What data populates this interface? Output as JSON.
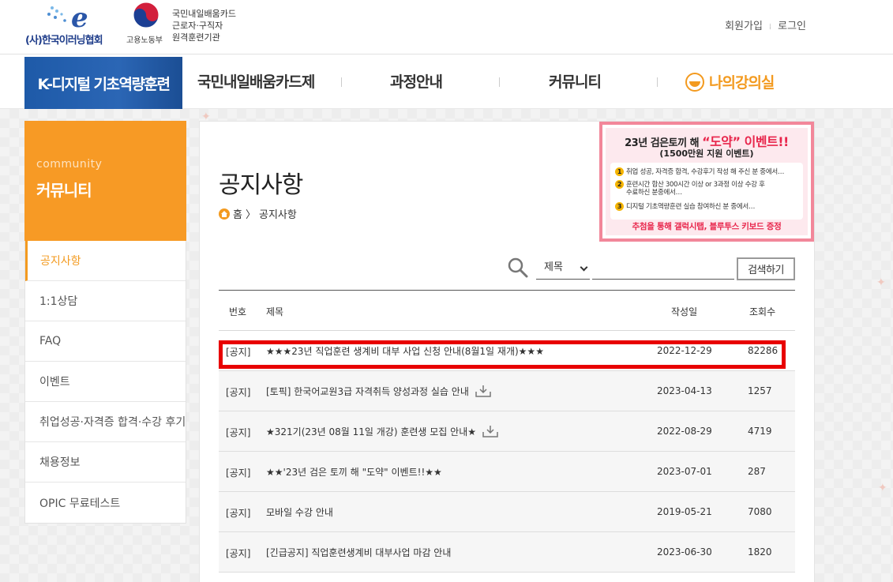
{
  "header": {
    "org_name": "(사)한국이러닝협회",
    "ministry": "고용노동부",
    "gov_lines": [
      "국민내일배움카드",
      "근로자·구직자",
      "원격훈련기관"
    ],
    "links": {
      "signup": "회원가입",
      "login": "로그인"
    }
  },
  "nav": {
    "brand": "K-디지털 기초역량훈련",
    "items": [
      "국민내일배움카드제",
      "과정안내",
      "커뮤니티"
    ],
    "my_lecture": "나의강의실"
  },
  "sidebar": {
    "subtitle": "community",
    "title": "커뮤니티",
    "items": [
      {
        "label": "공지사항",
        "active": true
      },
      {
        "label": "1:1상담"
      },
      {
        "label": "FAQ"
      },
      {
        "label": "이벤트"
      },
      {
        "label": "취업성공·자격증 합격·수강 후기"
      },
      {
        "label": "채용정보"
      },
      {
        "label": "OPIC 무료테스트"
      }
    ]
  },
  "main": {
    "title": "공지사항",
    "breadcrumb": {
      "home": "홈",
      "current": "공지사항"
    }
  },
  "banner": {
    "title_pre": "23년 검은토끼 해",
    "title_hl": "“도약” 이벤트!!",
    "subtitle": "(1500만원 지원 이벤트)",
    "lines": [
      "취업 성공, 자격증 합격, 수강후기 작성 해 주신 분 중에서…",
      "훈련시간 합산 300시간 이상 or 3과정 이상 수강 후",
      "수료하신 분중에서…",
      "디지털 기초역량훈련 실습 참여하신 분 중에서…"
    ],
    "footer": "추첨을 통해 갤럭시탭, 블루투스 키보드 증정"
  },
  "search": {
    "field_option": "제목",
    "input_value": "",
    "button": "검색하기"
  },
  "table": {
    "headers": {
      "no": "번호",
      "title": "제목",
      "date": "작성일",
      "views": "조회수"
    },
    "rows": [
      {
        "no": "[공지]",
        "title": "★★★23년 직업훈련 생계비 대부 사업 신청 안내(8월1일 재개)★★★",
        "date": "2022-12-29",
        "views": "82286",
        "attachment": false
      },
      {
        "no": "[공지]",
        "title": "[토픽] 한국어교원3급 자격취득 양성과정 실습 안내",
        "date": "2023-04-13",
        "views": "1257",
        "attachment": true
      },
      {
        "no": "[공지]",
        "title": "★321기(23년 08월 11일 개강) 훈련생 모집 안내★",
        "date": "2022-08-29",
        "views": "4719",
        "attachment": true
      },
      {
        "no": "[공지]",
        "title": "★★'23년 검은 토끼 해 \"도약\" 이벤트!!★★",
        "date": "2023-07-01",
        "views": "287",
        "attachment": false
      },
      {
        "no": "[공지]",
        "title": "모바일 수강 안내",
        "date": "2019-05-21",
        "views": "7080",
        "attachment": false
      },
      {
        "no": "[공지]",
        "title": "[긴급공지] 직업훈련생계비 대부사업 마감 안내",
        "date": "2023-06-30",
        "views": "1820",
        "attachment": false
      }
    ]
  },
  "colors": {
    "accent": "#f79a25",
    "brand_blue": "#1e5aa8",
    "highlight_red": "#e80000"
  }
}
